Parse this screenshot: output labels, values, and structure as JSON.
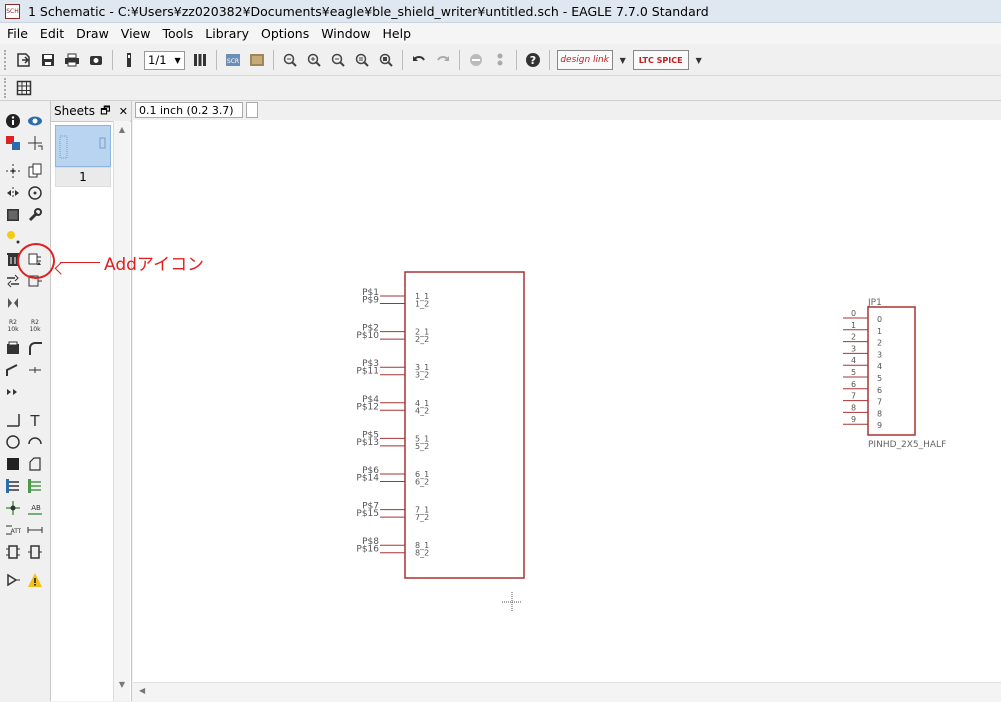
{
  "window": {
    "title": "1 Schematic - C:¥Users¥zz020382¥Documents¥eagle¥ble_shield_writer¥untitled.sch - EAGLE 7.7.0 Standard",
    "app_icon_text": "SCH"
  },
  "menu": [
    "File",
    "Edit",
    "Draw",
    "View",
    "Tools",
    "Library",
    "Options",
    "Window",
    "Help"
  ],
  "toolbar": {
    "sheet_select": "1/1",
    "designlink_label": "design link",
    "ltspice_label": "LTC SPICE"
  },
  "sheets_panel": {
    "title": "Sheets",
    "sheet_number": "1"
  },
  "coordinate": {
    "readout": "0.1 inch (0.2 3.7)"
  },
  "annotation": {
    "text": "Addアイコン",
    "color": "#e02020"
  },
  "colors": {
    "schematic_outline": "#a83232",
    "pin": "#a83232",
    "text": "#555555"
  },
  "schematic": {
    "part1": {
      "left_labels": [
        "P$1",
        "P$9",
        "P$2",
        "P$10",
        "P$3",
        "P$11",
        "P$4",
        "P$12",
        "P$5",
        "P$13",
        "P$6",
        "P$14",
        "P$7",
        "P$15",
        "P$8",
        "P$16"
      ],
      "inner_labels": [
        "1_1",
        "1_2",
        "2_1",
        "2_2",
        "3_1",
        "3_2",
        "4_1",
        "4_2",
        "5_1",
        "5_2",
        "6_1",
        "6_2",
        "7_1",
        "7_2",
        "8_1",
        "8_2"
      ]
    },
    "part2": {
      "name": "JP1",
      "value": "PINHD_2X5_HALF",
      "pin_labels": [
        "0",
        "1",
        "2",
        "3",
        "4",
        "5",
        "6",
        "7",
        "8",
        "9"
      ],
      "inner_labels": [
        "0",
        "1",
        "2",
        "3",
        "4",
        "5",
        "6",
        "7",
        "8",
        "9"
      ]
    }
  }
}
